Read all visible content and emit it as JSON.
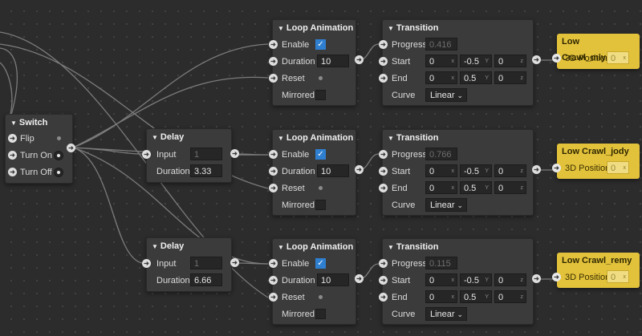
{
  "switch_node": {
    "title": "Switch",
    "rows": [
      {
        "label": "Flip"
      },
      {
        "label": "Turn On"
      },
      {
        "label": "Turn Off"
      }
    ]
  },
  "delay_nodes": [
    {
      "title": "Delay",
      "input_label": "Input",
      "input_value": "1",
      "duration_label": "Duration",
      "duration_value": "3.33"
    },
    {
      "title": "Delay",
      "input_label": "Input",
      "input_value": "1",
      "duration_label": "Duration",
      "duration_value": "6.66"
    }
  ],
  "loop_nodes": [
    {
      "title": "Loop Animation",
      "enable_label": "Enable",
      "enable_checked": true,
      "duration_label": "Duration",
      "duration_value": "10",
      "reset_label": "Reset",
      "mirrored_label": "Mirrored"
    },
    {
      "title": "Loop Animation",
      "enable_label": "Enable",
      "enable_checked": true,
      "duration_label": "Duration",
      "duration_value": "10",
      "reset_label": "Reset",
      "mirrored_label": "Mirrored"
    },
    {
      "title": "Loop Animation",
      "enable_label": "Enable",
      "enable_checked": true,
      "duration_label": "Duration",
      "duration_value": "10",
      "reset_label": "Reset",
      "mirrored_label": "Mirrored"
    }
  ],
  "transition_nodes": [
    {
      "title": "Transition",
      "progress_label": "Progress",
      "progress_value": "0.416",
      "start_label": "Start",
      "start": [
        "0",
        "-0.5",
        "0"
      ],
      "end_label": "End",
      "end": [
        "0",
        "0.5",
        "0"
      ],
      "curve_label": "Curve",
      "curve_value": "Linear"
    },
    {
      "title": "Transition",
      "progress_label": "Progress",
      "progress_value": "0.766",
      "start_label": "Start",
      "start": [
        "0",
        "-0.5",
        "0"
      ],
      "end_label": "End",
      "end": [
        "0",
        "0.5",
        "0"
      ],
      "curve_label": "Curve",
      "curve_value": "Linear"
    },
    {
      "title": "Transition",
      "progress_label": "Progress",
      "progress_value": "0.115",
      "start_label": "Start",
      "start": [
        "0",
        "-0.5",
        "0"
      ],
      "end_label": "End",
      "end": [
        "0",
        "0.5",
        "0"
      ],
      "curve_label": "Curve",
      "curve_value": "Linear"
    }
  ],
  "object_nodes": [
    {
      "title": "Low Crawl_miyano",
      "prop_label": "3D Position",
      "value": "0"
    },
    {
      "title": "Low Crawl_jody",
      "prop_label": "3D Position",
      "value": "0"
    },
    {
      "title": "Low Crawl_remy",
      "prop_label": "3D Position",
      "value": "0"
    }
  ],
  "axis_labels": {
    "x": "x",
    "y": "Y",
    "z": "z"
  },
  "colors": {
    "background": "#2c2c2c",
    "node": "#3b3b3b",
    "object_node": "#e3c23b",
    "wire": "#8a8a8a",
    "checkbox": "#2f7fd1"
  },
  "icons": {
    "port": "arrow-right-circle-icon",
    "collapse": "triangle-down-icon",
    "dropdown": "chevron-down-icon"
  }
}
